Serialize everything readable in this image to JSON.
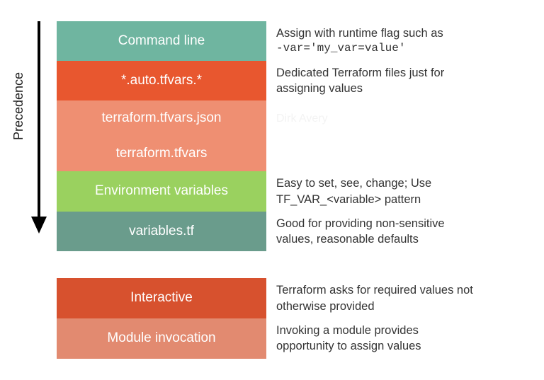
{
  "axis_label": "Precedence",
  "watermark": "Dirk Avery",
  "rows": [
    {
      "label": "Command line",
      "color": "#6fb5a0",
      "desc1": "Assign with runtime flag such as",
      "desc2": "-var='my_var=value'",
      "code": true
    },
    {
      "label": "*.auto.tfvars.*",
      "color": "#e8572f",
      "desc1": "Dedicated Terraform files just for",
      "desc2": "assigning values"
    },
    {
      "label": "terraform.tfvars.json",
      "color": "#ef8f72",
      "desc1": "",
      "desc2": "",
      "watermark": true
    },
    {
      "label": "terraform.tfvars",
      "color": "#ef8f72",
      "desc1": "",
      "desc2": ""
    },
    {
      "label": "Environment variables",
      "color": "#9ad15f",
      "desc1": "Easy to set, see, change; Use",
      "desc2": "TF_VAR_<variable> pattern"
    },
    {
      "label": "variables.tf",
      "color": "#6a9c8c",
      "desc1": "Good for providing non-sensitive",
      "desc2": "values, reasonable defaults"
    }
  ],
  "rows2": [
    {
      "label": "Interactive",
      "color": "#d7512e",
      "desc1": "Terraform asks for required values not",
      "desc2": "otherwise provided"
    },
    {
      "label": "Module invocation",
      "color": "#e28a70",
      "desc1": "Invoking a module provides",
      "desc2": "opportunity to assign values"
    }
  ]
}
